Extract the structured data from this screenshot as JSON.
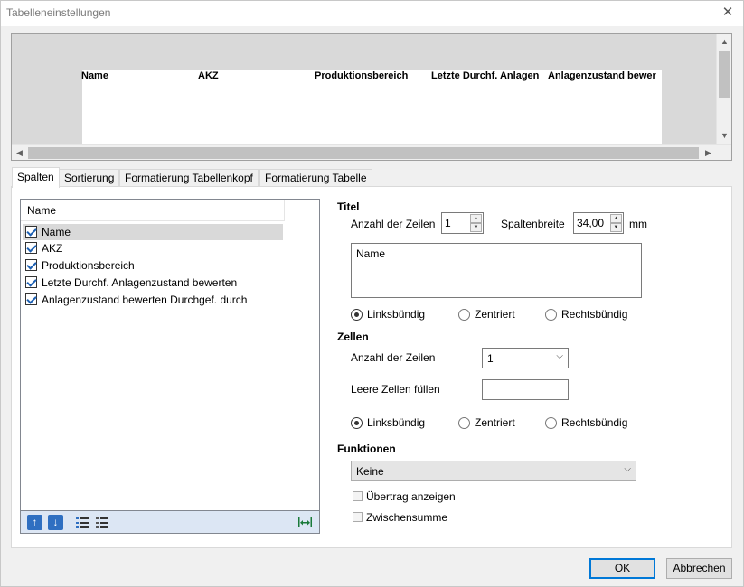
{
  "window": {
    "title": "Tabelleneinstellungen",
    "close_glyph": "✕"
  },
  "preview": {
    "columns": [
      "Name",
      "AKZ",
      "Produktionsbereich",
      "Letzte Durchf. Anlagen",
      "Anlagenzustand bewer"
    ]
  },
  "tabs": [
    {
      "label": "Spalten",
      "active": true
    },
    {
      "label": "Sortierung",
      "active": false
    },
    {
      "label": "Formatierung Tabellenkopf",
      "active": false
    },
    {
      "label": "Formatierung Tabelle",
      "active": false
    }
  ],
  "column_list": {
    "header": "Name",
    "items": [
      {
        "label": "Name",
        "checked": true,
        "selected": true
      },
      {
        "label": "AKZ",
        "checked": true,
        "selected": false
      },
      {
        "label": "Produktionsbereich",
        "checked": true,
        "selected": false
      },
      {
        "label": "Letzte Durchf. Anlagenzustand bewerten",
        "checked": true,
        "selected": false
      },
      {
        "label": "Anlagenzustand bewerten Durchgef. durch",
        "checked": true,
        "selected": false
      }
    ]
  },
  "titel": {
    "section": "Titel",
    "rows_label": "Anzahl der Zeilen",
    "rows_value": "1",
    "width_label": "Spaltenbreite",
    "width_value": "34,00",
    "width_unit": "mm",
    "text": "Name",
    "align": {
      "left": "Linksbündig",
      "center": "Zentriert",
      "right": "Rechtsbündig",
      "selected": "left"
    }
  },
  "zellen": {
    "section": "Zellen",
    "rows_label": "Anzahl der Zeilen",
    "rows_value": "1",
    "fill_label": "Leere Zellen füllen",
    "fill_value": "",
    "align": {
      "left": "Linksbündig",
      "center": "Zentriert",
      "right": "Rechtsbündig",
      "selected": "left"
    }
  },
  "funktionen": {
    "section": "Funktionen",
    "value": "Keine",
    "uebertrag_label": "Übertrag anzeigen",
    "zwischensumme_label": "Zwischensumme"
  },
  "buttons": {
    "ok": "OK",
    "cancel": "Abbrechen"
  },
  "colors": {
    "accent": "#0078d7",
    "toolbar": "#dce6f4",
    "check": "#1b5fb3"
  }
}
